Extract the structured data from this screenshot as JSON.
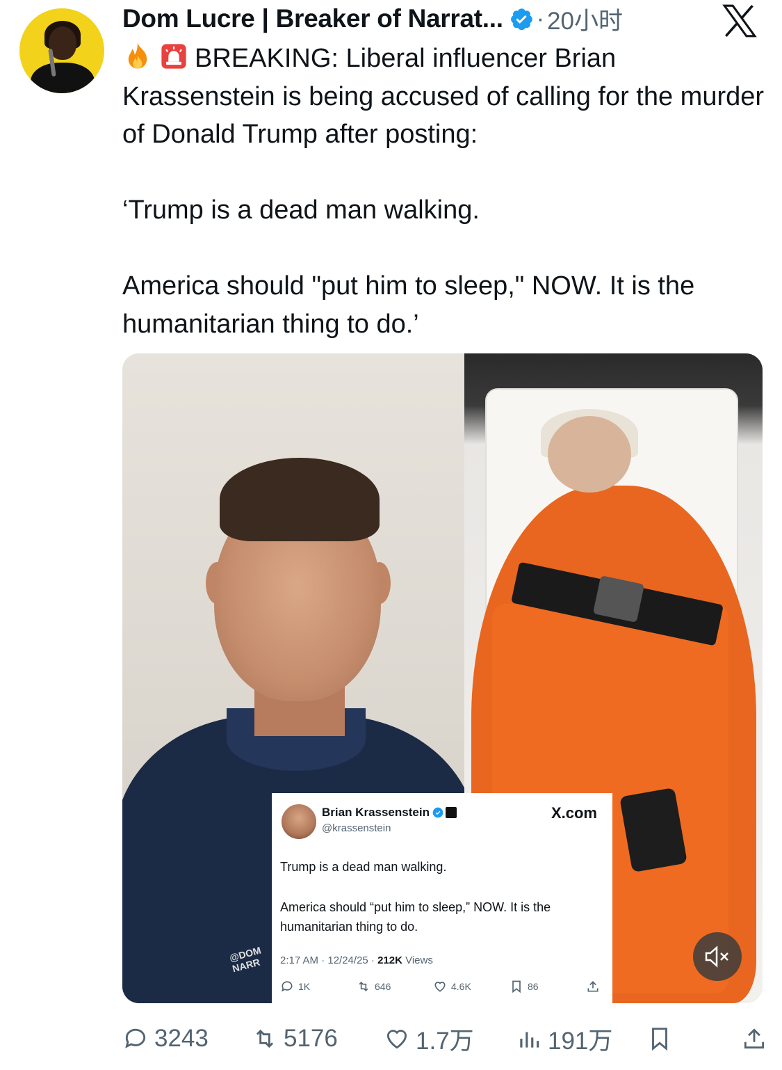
{
  "author": {
    "display_name": "Dom Lucre | Breaker of Narrat...",
    "verified": true,
    "separator": "·",
    "timestamp": "20小时"
  },
  "brand_icon": "x-logo-icon",
  "tweet": {
    "line1": "BREAKING: Liberal influencer Brian Krassenstein is being accused of calling for the murder of Donald Trump after posting:",
    "line2": "‘Trump is a dead man walking.",
    "line3": "America should \"put him to sleep,\" NOW. It is the humanitarian thing to do.’",
    "emojis": [
      "fire-emoji",
      "siren-emoji"
    ]
  },
  "media": {
    "embedded_card": {
      "name": "Brian Krassenstein",
      "handle": "@krassenstein",
      "brand": "X.com",
      "text_line1": "Trump is a dead man walking.",
      "text_line2": "America should “put him to sleep,” NOW.  It is the humanitarian thing to do.",
      "meta_time": "2:17 AM · 12/24/25 · ",
      "meta_views_count": "212K",
      "meta_views_label": " Views",
      "replies": "1K",
      "reposts": "646",
      "likes": "4.6K",
      "bookmarks": "86"
    },
    "watermark": "@DOM NARR",
    "mute_icon": "speaker-muted-icon"
  },
  "actions": {
    "replies": "3243",
    "reposts": "5176",
    "likes": "1.7万",
    "views": "191万"
  },
  "colors": {
    "verified_blue": "#1d9bf0",
    "text_primary": "#0f1419",
    "text_secondary": "#536471",
    "avatar_bg": "#f2d21a"
  }
}
